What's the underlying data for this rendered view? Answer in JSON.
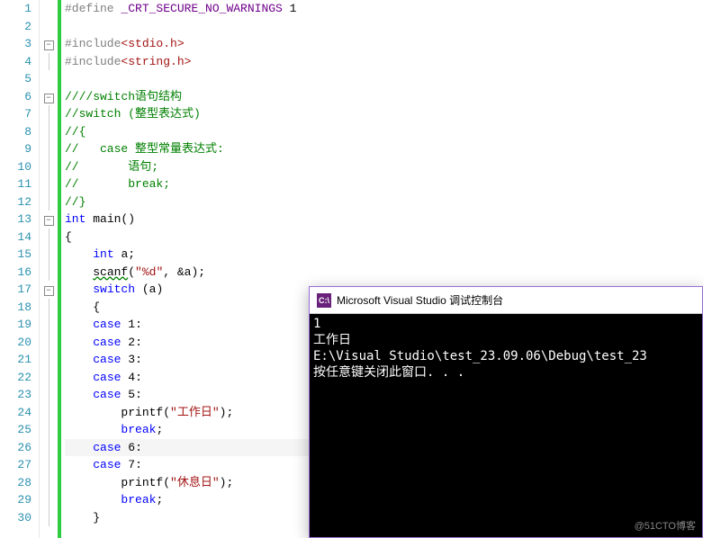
{
  "editor": {
    "lines": [
      {
        "n": 1,
        "fold": "",
        "html": "<span class='mac'>#define </span><span class='macname'>_CRT_SECURE_NO_WARNINGS</span> <span class='num'>1</span>"
      },
      {
        "n": 2,
        "fold": "",
        "html": ""
      },
      {
        "n": 3,
        "fold": "box",
        "html": "<span class='inc'>#include</span><span class='hdr'>&lt;stdio.h&gt;</span>"
      },
      {
        "n": 4,
        "fold": "line",
        "html": "<span class='inc'>#include</span><span class='hdr'>&lt;string.h&gt;</span>"
      },
      {
        "n": 5,
        "fold": "",
        "html": ""
      },
      {
        "n": 6,
        "fold": "box",
        "html": "<span class='cmt'>////switch语句结构</span>"
      },
      {
        "n": 7,
        "fold": "line",
        "html": "<span class='cmt'>//switch (整型表达式)</span>"
      },
      {
        "n": 8,
        "fold": "line",
        "html": "<span class='cmt'>//{</span>"
      },
      {
        "n": 9,
        "fold": "line",
        "html": "<span class='cmt'>//   case 整型常量表达式:</span>"
      },
      {
        "n": 10,
        "fold": "line",
        "html": "<span class='cmt'>//       语句;</span>"
      },
      {
        "n": 11,
        "fold": "line",
        "html": "<span class='cmt'>//       break;</span>"
      },
      {
        "n": 12,
        "fold": "line",
        "html": "<span class='cmt'>//}</span>"
      },
      {
        "n": 13,
        "fold": "box",
        "html": "<span class='kw'>int</span> <span class='id'>main()</span>"
      },
      {
        "n": 14,
        "fold": "line",
        "html": "<span class='id'>{</span>"
      },
      {
        "n": 15,
        "fold": "line",
        "html": "    <span class='kw'>int</span> <span class='id'>a;</span>"
      },
      {
        "n": 16,
        "fold": "line",
        "html": "    <span class='id wavy'>scanf</span><span class='id'>(</span><span class='str'>\"%d\"</span><span class='id'>, &amp;a);</span>"
      },
      {
        "n": 17,
        "fold": "box",
        "html": "    <span class='kw'>switch</span> <span class='id'>(a)</span>"
      },
      {
        "n": 18,
        "fold": "line",
        "html": "    <span class='id'>{</span>"
      },
      {
        "n": 19,
        "fold": "line",
        "html": "    <span class='kw'>case</span> <span class='num'>1</span><span class='id'>:</span>"
      },
      {
        "n": 20,
        "fold": "line",
        "html": "    <span class='kw'>case</span> <span class='num'>2</span><span class='id'>:</span>"
      },
      {
        "n": 21,
        "fold": "line",
        "html": "    <span class='kw'>case</span> <span class='num'>3</span><span class='id'>:</span>"
      },
      {
        "n": 22,
        "fold": "line",
        "html": "    <span class='kw'>case</span> <span class='num'>4</span><span class='id'>:</span>"
      },
      {
        "n": 23,
        "fold": "line",
        "html": "    <span class='kw'>case</span> <span class='num'>5</span><span class='id'>:</span>"
      },
      {
        "n": 24,
        "fold": "line",
        "html": "        <span class='id'>printf(</span><span class='str'>\"工作日\"</span><span class='id'>);</span>"
      },
      {
        "n": 25,
        "fold": "line",
        "html": "        <span class='kw'>break</span><span class='id'>;</span>"
      },
      {
        "n": 26,
        "fold": "line",
        "hl": true,
        "html": "    <span class='kw'>case</span> <span class='num'>6</span><span class='id'>:</span>"
      },
      {
        "n": 27,
        "fold": "line",
        "html": "    <span class='kw'>case</span> <span class='num'>7</span><span class='id'>:</span>"
      },
      {
        "n": 28,
        "fold": "line",
        "html": "        <span class='id'>printf(</span><span class='str'>\"休息日\"</span><span class='id'>);</span>"
      },
      {
        "n": 29,
        "fold": "line",
        "html": "        <span class='kw'>break</span><span class='id'>;</span>"
      },
      {
        "n": 30,
        "fold": "line",
        "html": "    <span class='id'>}</span>"
      }
    ]
  },
  "console": {
    "icon_text": "C:\\",
    "title": "Microsoft Visual Studio 调试控制台",
    "output": "1\n工作日\nE:\\Visual Studio\\test_23.09.06\\Debug\\test_23\n按任意键关闭此窗口. . ."
  },
  "watermark": "@51CTO博客"
}
